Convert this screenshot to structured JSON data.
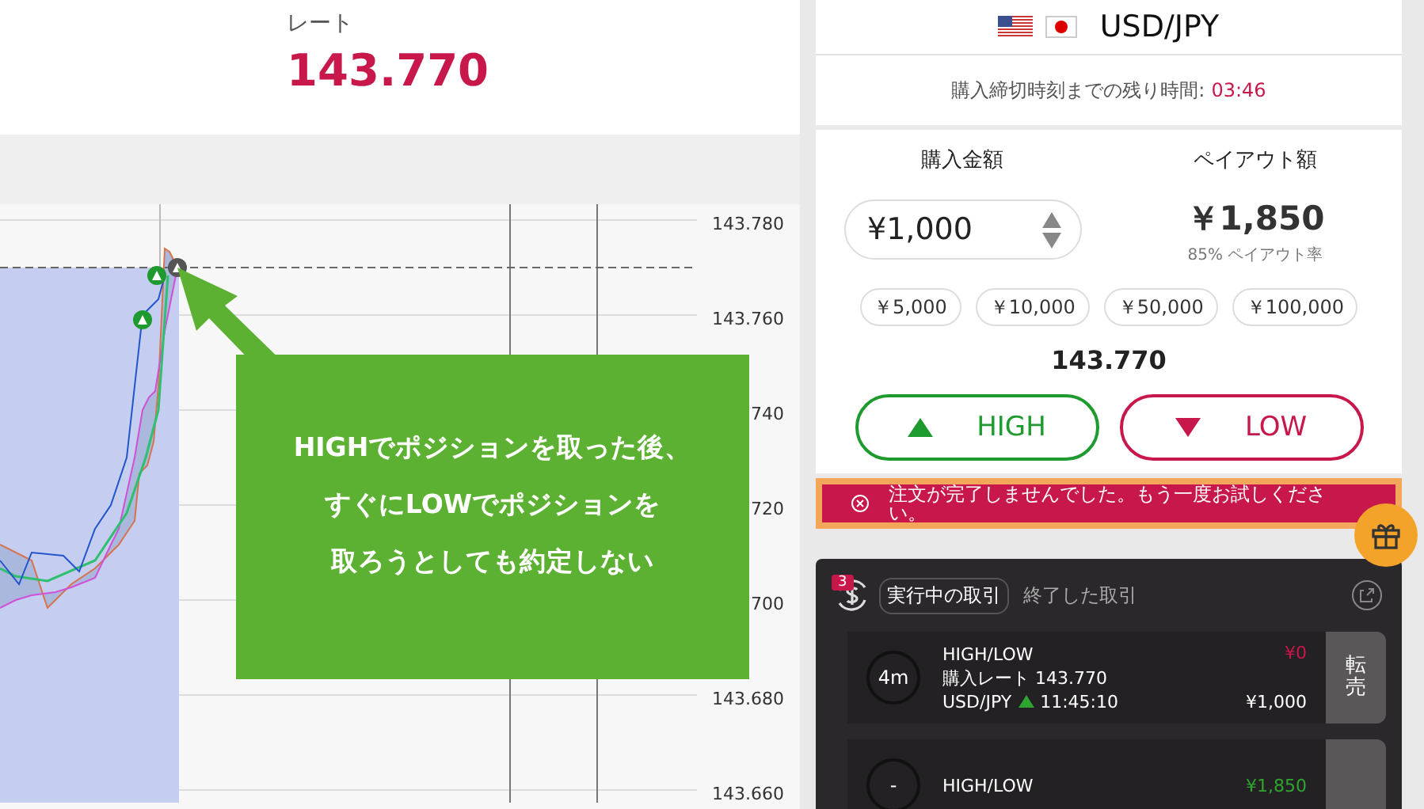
{
  "rate_panel": {
    "label": "レート",
    "value": "143.770"
  },
  "chart": {
    "y_labels": [
      "143.780",
      "143.760",
      "740",
      "720",
      "700",
      "143.680",
      "143.660"
    ]
  },
  "callout": {
    "lines": [
      "HIGHでポジションを取った後、",
      "すぐにLOWでポジションを",
      "取ろうとしても約定しない"
    ]
  },
  "order_panel": {
    "pair": "USD/JPY",
    "deadline_label": "購入締切時刻までの残り時間:",
    "deadline_time": "03:46",
    "amount_label": "購入金額",
    "payout_label": "ペイアウト額",
    "amount": "¥1,000",
    "payout": "￥1,850",
    "payout_rate": "85% ペイアウト率",
    "presets": [
      "￥5,000",
      "￥10,000",
      "￥50,000",
      "￥100,000"
    ],
    "current_rate": "143.770",
    "buttons": [
      {
        "kind": "high",
        "label": "HIGH"
      },
      {
        "kind": "low",
        "label": "LOW"
      }
    ]
  },
  "error_banner": {
    "message": "注文が完了しませんでした。もう一度お試しください。"
  },
  "trades": {
    "badge": "3",
    "tabs": [
      {
        "label": "実行中の取引",
        "selected": true
      },
      {
        "label": "終了した取引",
        "selected": false
      }
    ],
    "rows": [
      {
        "timer": "4m",
        "type": "HIGH/LOW",
        "rate": "購入レート 143.770",
        "pair": "USD/JPY",
        "rising": true,
        "time": "11:45:10",
        "payout": "¥0",
        "color": "#c8174a",
        "amount": "¥1,000",
        "action": "転売"
      },
      {
        "timer": "-",
        "type": "HIGH/LOW",
        "payout": "¥1,850",
        "color": "#2fa52f"
      }
    ]
  }
}
